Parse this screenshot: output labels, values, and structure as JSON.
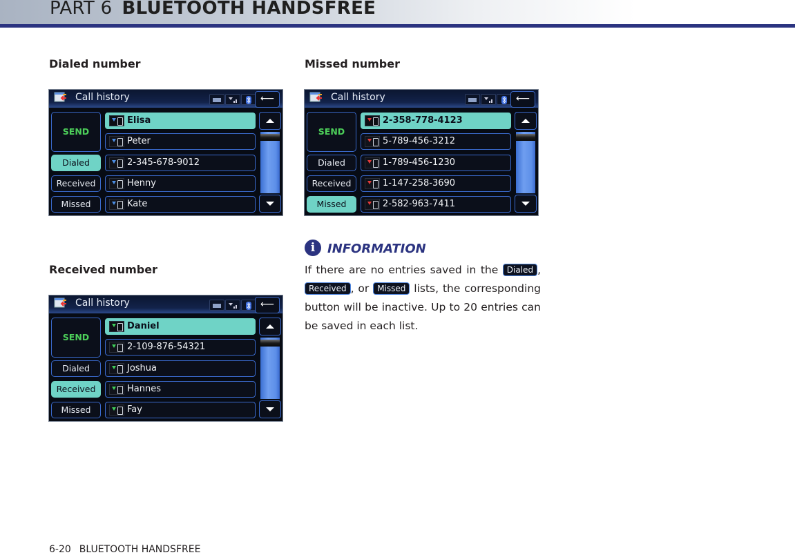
{
  "header": {
    "part": "PART 6",
    "title": "BLUETOOTH HANDSFREE"
  },
  "sections": {
    "dialed": "Dialed number",
    "received": "Received number",
    "missed": "Missed number"
  },
  "screen_common": {
    "title": "Call history",
    "send": "SEND",
    "dialed": "Dialed",
    "received": "Received",
    "missed": "Missed",
    "back_glyph": "⟵",
    "status_icons": [
      "battery-icon",
      "signal-icon",
      "bluetooth-icon"
    ]
  },
  "screens": {
    "dialed": {
      "active_tab": "Dialed",
      "icon_color": "#4b8ee6",
      "entries": [
        "Elisa",
        "Peter",
        "2-345-678-9012",
        "Henny",
        "Kate"
      ]
    },
    "received": {
      "active_tab": "Received",
      "icon_color": "#3fcf5a",
      "entries": [
        "Daniel",
        "2-109-876-54321",
        "Joshua",
        "Hannes",
        "Fay"
      ]
    },
    "missed": {
      "active_tab": "Missed",
      "icon_color": "#e23a3a",
      "entries": [
        "2-358-778-4123",
        "5-789-456-3212",
        "1-789-456-1230",
        "1-147-258-3690",
        "2-582-963-7411"
      ]
    }
  },
  "info": {
    "icon": "i",
    "title": "INFORMATION",
    "text_1": "If there are no entries saved in the ",
    "chip_dialed": "Dialed",
    "text_2": ",",
    "chip_received": "Received",
    "text_3": ", or ",
    "chip_missed": "Missed",
    "text_4": " lists, the corresponding button will be inactive. Up to 20 entries can be saved in each list."
  },
  "footer": {
    "page": "6-20",
    "label": "BLUETOOTH HANDSFREE"
  },
  "colors": {
    "accent": "#2b3380",
    "active_button": "#6fd3c6",
    "send_text": "#4dd05a"
  }
}
